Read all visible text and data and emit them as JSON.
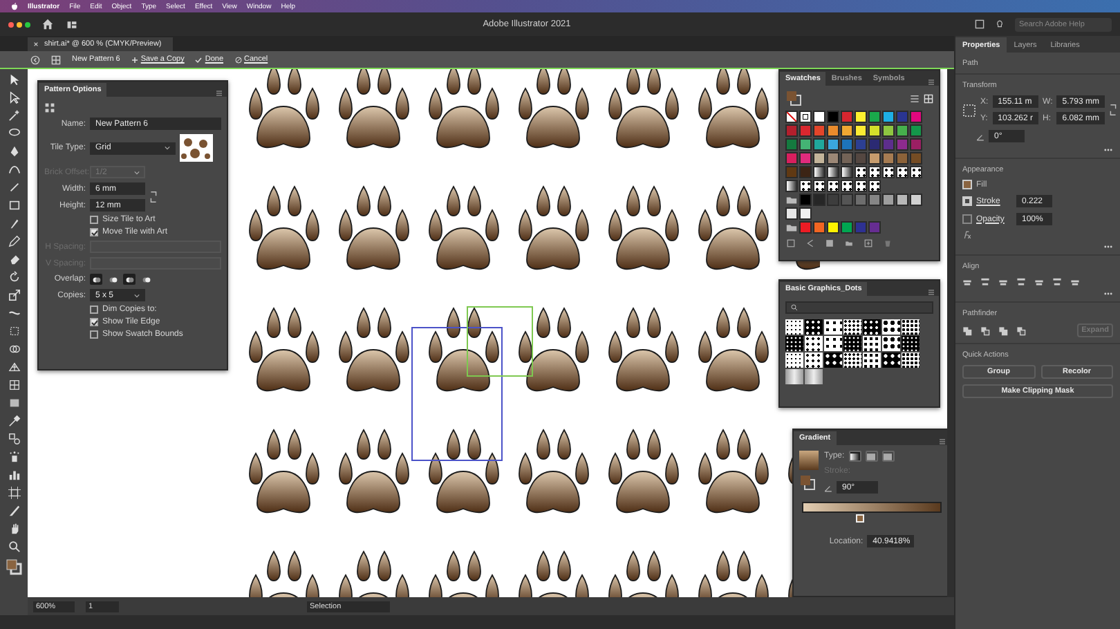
{
  "menu_bar": {
    "items": [
      "Illustrator",
      "File",
      "Edit",
      "Object",
      "Type",
      "Select",
      "Effect",
      "View",
      "Window",
      "Help"
    ]
  },
  "window": {
    "title": "Adobe Illustrator 2021",
    "search": {
      "placeholder": "Search Adobe Help"
    }
  },
  "document_tab": {
    "title": "shirt.ai* @ 600 % (CMYK/Preview)"
  },
  "pattern_bar": {
    "name": "New Pattern 6",
    "actions": [
      {
        "kind": "add",
        "label": "Save a Copy"
      },
      {
        "kind": "done",
        "label": "Done"
      },
      {
        "kind": "cancel",
        "label": "Cancel"
      }
    ]
  },
  "pattern_options": {
    "title": "Pattern Options",
    "rows": [
      {
        "kind": "field",
        "label": "Name:",
        "value": "New Pattern 6",
        "disabled": false
      },
      {
        "kind": "dropdown",
        "label": "Tile Type:",
        "value": "Grid",
        "disabled": false,
        "preview": true
      },
      {
        "kind": "dropdown",
        "label": "Brick Offset:",
        "value": "1/2",
        "disabled": true
      },
      {
        "kind": "size",
        "fields": [
          {
            "label": "Width:",
            "value": "6 mm"
          },
          {
            "label": "Height:",
            "value": "12 mm"
          }
        ]
      },
      {
        "kind": "checkbox",
        "label": "Size Tile to Art",
        "checked": false
      },
      {
        "kind": "checkbox",
        "label": "Move Tile with Art",
        "checked": true
      },
      {
        "kind": "field",
        "label": "H Spacing:",
        "disabled": true
      },
      {
        "kind": "field",
        "label": "V Spacing:",
        "disabled": true
      },
      {
        "kind": "overlap",
        "label": "Overlap:",
        "options": [
          {
            "selected": true
          },
          {
            "selected": false
          },
          {
            "selected": true
          },
          {
            "selected": false
          }
        ]
      },
      {
        "kind": "dropdown",
        "label": "Copies:",
        "value": "5 x 5",
        "disabled": false
      },
      {
        "kind": "checkbox",
        "label": "Dim Copies to:",
        "checked": false
      },
      {
        "kind": "checkbox",
        "label": "Show Tile Edge",
        "checked": true
      },
      {
        "kind": "checkbox",
        "label": "Show Swatch Bounds",
        "checked": false
      }
    ]
  },
  "swatches_panel": {
    "tabs": [
      {
        "label": "Swatches",
        "selected": true
      },
      {
        "label": "Brushes",
        "selected": false
      },
      {
        "label": "Symbols",
        "selected": false
      }
    ],
    "rows": [
      [
        {
          "kind": "none"
        },
        {
          "kind": "registration"
        },
        {
          "kind": "color",
          "color": "#ffffff"
        },
        {
          "kind": "color",
          "color": "#000000"
        },
        {
          "kind": "color",
          "color": "#d7262f"
        },
        {
          "kind": "color",
          "color": "#fdf02f"
        },
        {
          "kind": "color",
          "color": "#1aa84b"
        },
        {
          "kind": "color",
          "color": "#1eaee5"
        },
        {
          "kind": "color",
          "color": "#2a3591"
        },
        {
          "kind": "color",
          "color": "#e2077e"
        }
      ],
      [
        {
          "kind": "color",
          "color": "#b31f2d"
        },
        {
          "kind": "color",
          "color": "#d9272f"
        },
        {
          "kind": "color",
          "color": "#e3452a"
        },
        {
          "kind": "color",
          "color": "#ea8b2c"
        },
        {
          "kind": "color",
          "color": "#f0a732"
        },
        {
          "kind": "color",
          "color": "#fbeb33"
        },
        {
          "kind": "color",
          "color": "#d4df2a"
        },
        {
          "kind": "color",
          "color": "#8ec641"
        },
        {
          "kind": "color",
          "color": "#46b04c"
        },
        {
          "kind": "color",
          "color": "#14974a"
        }
      ],
      [
        {
          "kind": "color",
          "color": "#157a3f"
        },
        {
          "kind": "color",
          "color": "#44b374"
        },
        {
          "kind": "color",
          "color": "#20a79c"
        },
        {
          "kind": "color",
          "color": "#3aa7dd"
        },
        {
          "kind": "color",
          "color": "#1d74ba"
        },
        {
          "kind": "color",
          "color": "#2c3f92"
        },
        {
          "kind": "color",
          "color": "#2b2a73"
        },
        {
          "kind": "color",
          "color": "#5d2e8c"
        },
        {
          "kind": "color",
          "color": "#8d2b8e"
        },
        {
          "kind": "color",
          "color": "#9b1f63"
        }
      ],
      [
        {
          "kind": "color",
          "color": "#d81f5e"
        },
        {
          "kind": "color",
          "color": "#e02b7d"
        },
        {
          "kind": "color",
          "color": "#c3b49a"
        },
        {
          "kind": "color",
          "color": "#9b8776"
        },
        {
          "kind": "color",
          "color": "#736357"
        },
        {
          "kind": "color",
          "color": "#544741"
        },
        {
          "kind": "color",
          "color": "#c69c6d"
        },
        {
          "kind": "color",
          "color": "#a67c52"
        },
        {
          "kind": "color",
          "color": "#8c6239"
        },
        {
          "kind": "color",
          "color": "#754c24"
        }
      ],
      [
        {
          "kind": "color",
          "color": "#603913"
        },
        {
          "kind": "color",
          "color": "#3c2415"
        },
        {
          "kind": "gradient"
        },
        {
          "kind": "gradient"
        },
        {
          "kind": "gradient"
        },
        {
          "kind": "pattern"
        },
        {
          "kind": "pattern"
        },
        {
          "kind": "pattern"
        },
        {
          "kind": "pattern"
        },
        {
          "kind": "pattern"
        }
      ],
      [
        {
          "kind": "gradient"
        },
        {
          "kind": "pattern"
        },
        {
          "kind": "pattern"
        },
        {
          "kind": "pattern"
        },
        {
          "kind": "pattern"
        },
        {
          "kind": "pattern"
        },
        {
          "kind": "pattern"
        }
      ],
      [
        {
          "kind": "folder"
        },
        {
          "kind": "color",
          "color": "#000000"
        },
        {
          "kind": "color",
          "color": "#262626"
        },
        {
          "kind": "color",
          "color": "#3d3d3d"
        },
        {
          "kind": "color",
          "color": "#555555"
        },
        {
          "kind": "color",
          "color": "#6d6d6d"
        },
        {
          "kind": "color",
          "color": "#868686"
        },
        {
          "kind": "color",
          "color": "#9e9e9e"
        },
        {
          "kind": "color",
          "color": "#b7b7b7"
        },
        {
          "kind": "color",
          "color": "#d1d1d1"
        }
      ],
      [
        {
          "kind": "color",
          "color": "#e6e6e6"
        },
        {
          "kind": "color",
          "color": "#f2f2f2"
        }
      ],
      [
        {
          "kind": "folder"
        },
        {
          "kind": "color",
          "color": "#ec1c24"
        },
        {
          "kind": "color",
          "color": "#f26522"
        },
        {
          "kind": "color",
          "color": "#fff200"
        },
        {
          "kind": "color",
          "color": "#00a651"
        },
        {
          "kind": "color",
          "color": "#2e3192"
        },
        {
          "kind": "color",
          "color": "#662d91"
        }
      ]
    ]
  },
  "graphics_panel": {
    "title": "Basic Graphics_Dots"
  },
  "gradient_panel": {
    "title": "Gradient",
    "type_label": "Type:",
    "types": [
      {
        "selected": true
      },
      {
        "selected": false
      },
      {
        "selected": false
      }
    ],
    "stroke_label": "Stroke:",
    "angle": "90°",
    "slider": {
      "level": 0.409418
    },
    "location_label": "Location:",
    "location": "40.9418%"
  },
  "properties_panel": {
    "tabs": [
      {
        "label": "Properties",
        "selected": true
      },
      {
        "label": "Layers",
        "selected": false
      },
      {
        "label": "Libraries",
        "selected": false
      }
    ],
    "object_type": "Path",
    "transform": {
      "title": "Transform",
      "fields": [
        {
          "label": "X:",
          "value": "155.11 m"
        },
        {
          "label": "W:",
          "value": "5.793 mm"
        },
        {
          "label": "Y:",
          "value": "103.262 r"
        },
        {
          "label": "H:",
          "value": "6.082 mm"
        }
      ],
      "angle": "0°"
    },
    "appearance": {
      "title": "Appearance",
      "fill_label": "Fill",
      "stroke_label": "Stroke",
      "stroke_value": "0.222",
      "opacity_label": "Opacity",
      "opacity_value": "100%"
    },
    "align": {
      "title": "Align"
    },
    "pathfinder": {
      "title": "Pathfinder",
      "expand": "Expand"
    },
    "quick_actions": {
      "title": "Quick Actions",
      "buttons": [
        "Group",
        "Recolor",
        "Make Clipping Mask"
      ]
    }
  },
  "status_bar": {
    "zoom": "600%",
    "artboard": "1",
    "tool": "Selection"
  }
}
